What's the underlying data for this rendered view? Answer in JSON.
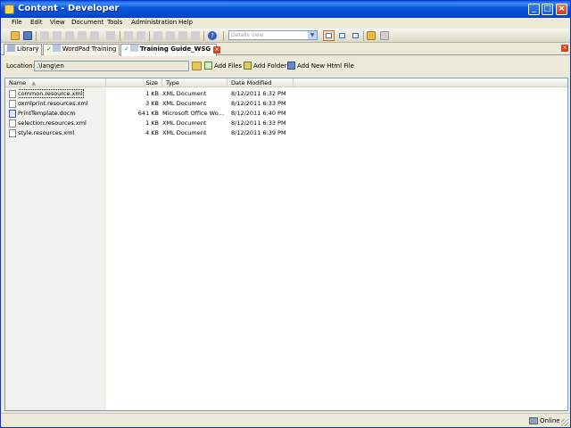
{
  "window": {
    "title": "Content - Developer"
  },
  "menu": {
    "items": [
      {
        "label": "File"
      },
      {
        "label": "Edit"
      },
      {
        "label": "View"
      },
      {
        "label": "Document"
      },
      {
        "label": "Tools"
      },
      {
        "label": "Administration"
      },
      {
        "label": "Help"
      }
    ]
  },
  "toolbar": {
    "view_select": "Details view"
  },
  "tabs": [
    {
      "label": "Library"
    },
    {
      "label": "WordPad Training"
    },
    {
      "label": "Training Guide_WSG"
    }
  ],
  "location": {
    "label": "Location:",
    "value": ".\\lang\\en",
    "add_files": "Add Files",
    "add_folder": "Add Folder",
    "add_html": "Add New Html File"
  },
  "grid": {
    "columns": [
      "Name",
      "Size",
      "Type",
      "Date Modified"
    ],
    "rows": [
      {
        "name": "common.resource.xml",
        "size": "1 KB",
        "type": "XML Document",
        "date": "8/12/2011 6:32 PM"
      },
      {
        "name": "oxmlprint.resources.xml",
        "size": "3 KB",
        "type": "XML Document",
        "date": "8/12/2011 6:33 PM"
      },
      {
        "name": "PrintTemplate.docm",
        "size": "641 KB",
        "type": "Microsoft Office Wo...",
        "date": "8/12/2011 6:40 PM"
      },
      {
        "name": "selection.resources.xml",
        "size": "1 KB",
        "type": "XML Document",
        "date": "8/12/2011 6:33 PM"
      },
      {
        "name": "style.resources.xml",
        "size": "4 KB",
        "type": "XML Document",
        "date": "8/12/2011 6:39 PM"
      }
    ]
  },
  "status": {
    "text": "Online"
  }
}
